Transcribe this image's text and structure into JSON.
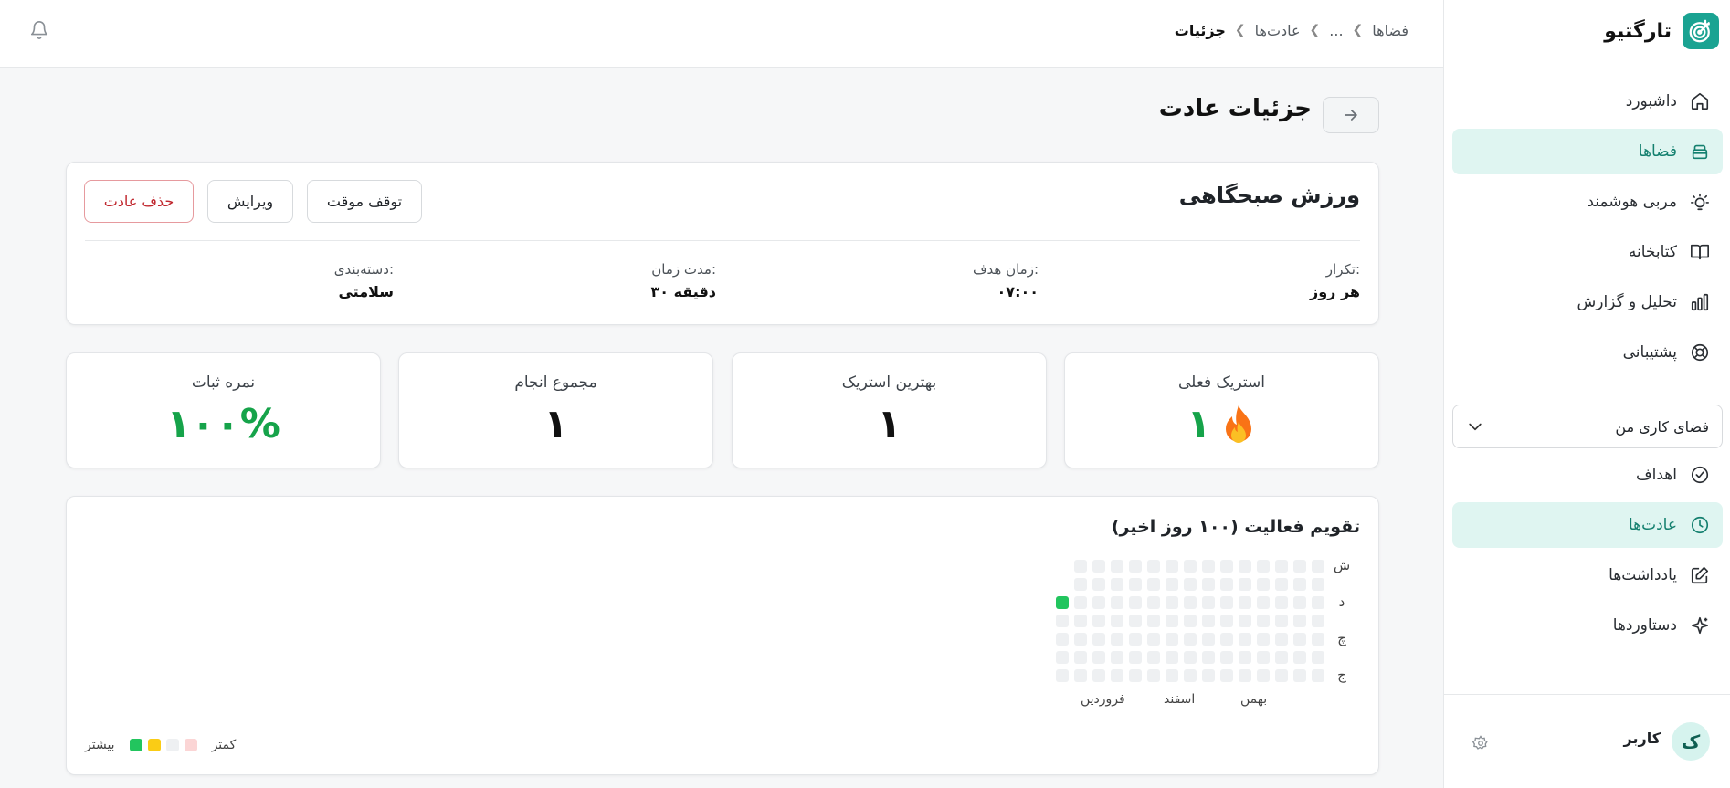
{
  "app": {
    "name": "تارگتیو",
    "accent": "#1aa392"
  },
  "breadcrumb": {
    "items": [
      "فضاها",
      "...",
      "عادت‌ها",
      "جزئیات"
    ]
  },
  "nav": [
    {
      "label": "داشبورد",
      "icon": "home-icon"
    },
    {
      "label": "فضاها",
      "icon": "layers-icon",
      "active": true
    },
    {
      "label": "مربی هوشمند",
      "icon": "lightbulb-icon"
    },
    {
      "label": "کتابخانه",
      "icon": "book-icon"
    },
    {
      "label": "تحلیل و گزارش",
      "icon": "bar-chart-icon"
    },
    {
      "label": "پشتیبانی",
      "icon": "lifebuoy-icon"
    }
  ],
  "workspace": {
    "label": "فضای کاری من"
  },
  "workspace_nav": [
    {
      "label": "اهداف",
      "icon": "check-circle-icon"
    },
    {
      "label": "عادت‌ها",
      "icon": "clock-icon",
      "active": true
    },
    {
      "label": "یادداشت‌ها",
      "icon": "edit-icon"
    },
    {
      "label": "دستاوردها",
      "icon": "sparkle-icon"
    }
  ],
  "user": {
    "initial": "ک",
    "name": "کاربر"
  },
  "page": {
    "title": "جزئیات عادت"
  },
  "habit": {
    "name": "ورزش صبحگاهی",
    "buttons": {
      "pause": "توقف موقت",
      "edit": "ویرایش",
      "delete": "حذف عادت"
    },
    "meta": [
      {
        "label": "تکرار:",
        "value": "هر روز"
      },
      {
        "label": "زمان هدف:",
        "value": "۰۷:۰۰"
      },
      {
        "label": "مدت زمان:",
        "value": "۳۰ دقیقه"
      },
      {
        "label": "دسته‌بندی:",
        "value": "سلامتی"
      }
    ]
  },
  "stats": [
    {
      "label": "استریک فعلی",
      "value": "۱",
      "icon": "fire-icon"
    },
    {
      "label": "بهترین استریک",
      "value": "۱"
    },
    {
      "label": "مجموع انجام",
      "value": "۱"
    },
    {
      "label": "نمره ثبات",
      "value": "۱۰۰%"
    }
  ],
  "activity": {
    "title": "تقویم فعالیت (۱۰۰ روز اخیر)",
    "days": [
      "ش",
      "د",
      "چ",
      "ج"
    ],
    "months": [
      "بهمن",
      "اسفند",
      "فروردین"
    ],
    "legend_less": "کمتر",
    "legend_more": "بیشتر",
    "legend_colors": [
      "#fbd5d5",
      "#eef0f2",
      "#facc15",
      "#22c55e"
    ],
    "active_day": {
      "row": 2,
      "col_from_left": 0
    }
  }
}
